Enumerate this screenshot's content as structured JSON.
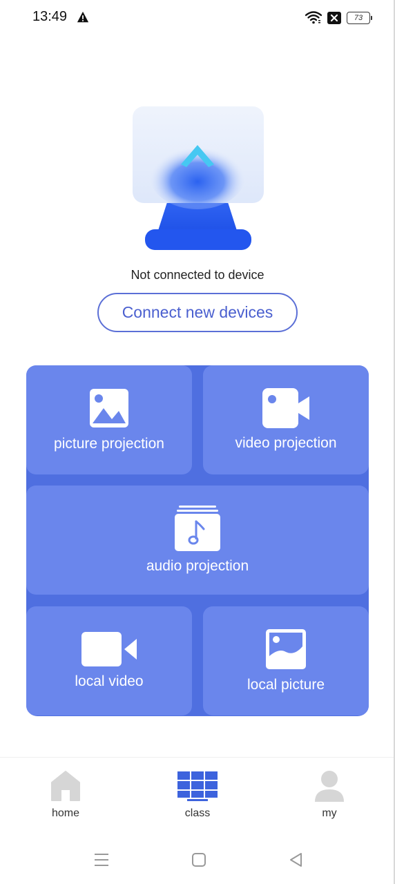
{
  "status_bar": {
    "time": "13:49",
    "battery": "73",
    "icons": [
      "warning-icon",
      "wifi-icon",
      "sim-off-icon",
      "battery-icon"
    ]
  },
  "hero": {
    "icon": "screen-cast-icon",
    "status_text": "Not connected to device",
    "connect_label": "Connect new devices"
  },
  "colors": {
    "accent": "#4a5fcf",
    "tile": "#6a86ec",
    "tile_bg": "#4f6fe0",
    "nav_active": "#3d63dd",
    "nav_inactive": "#d6d6d6"
  },
  "tiles": {
    "picture": {
      "label": "picture projection",
      "icon": "image-icon"
    },
    "video": {
      "label": "video projection",
      "icon": "video-camera-icon"
    },
    "audio": {
      "label": "audio projection",
      "icon": "music-album-icon"
    },
    "local_video": {
      "label": "local video",
      "icon": "video-camera-icon"
    },
    "local_picture": {
      "label": "local picture",
      "icon": "photo-icon"
    }
  },
  "bottom_nav": {
    "items": [
      {
        "label": "home",
        "icon": "home-icon",
        "active": false
      },
      {
        "label": "class",
        "icon": "grid-icon",
        "active": true
      },
      {
        "label": "my",
        "icon": "user-icon",
        "active": false
      }
    ]
  },
  "system_nav": {
    "icons": [
      "menu-icon",
      "home-square-icon",
      "back-icon"
    ]
  }
}
